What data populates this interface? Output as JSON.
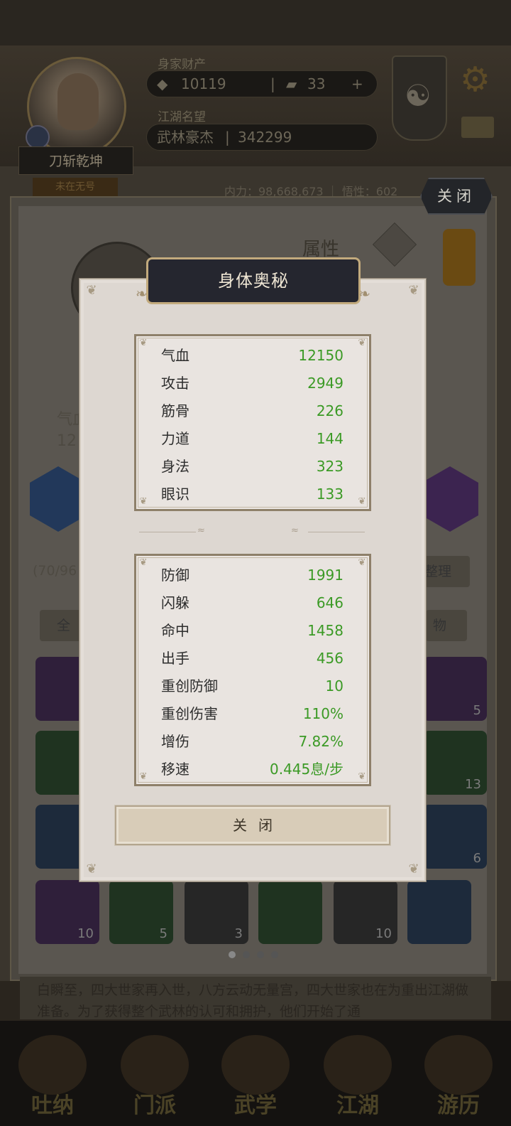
{
  "background": {
    "resources_label": "身家财产",
    "currency_1": "10119",
    "currency_2": "33",
    "plus": "+",
    "fame_label": "江湖名望",
    "rank_title": "武林豪杰",
    "fame_value": "342299",
    "player_name": "刀斩乾坤",
    "title_tag": "未在无号",
    "top_stats": "内力：98,668,673 ｜ 悟性：602",
    "attr_title": "属性",
    "left_partial_label": "气血",
    "left_partial_value": "12",
    "inventory_count": "(70/96",
    "sort_button": "整理",
    "filter_all": "全",
    "filter_items": "物",
    "story_text": "白瞬至，四大世家再入世，八方云动无量宫，四大世家也在为重出江湖做准备。为了获得整个武林的认可和拥护，他们开始了通",
    "slot_counts": [
      "5",
      "13",
      "6",
      "10",
      "5",
      "3",
      "10"
    ],
    "nav": [
      "吐纳",
      "门派",
      "武学",
      "江湖",
      "游历"
    ],
    "close_top": "关闭"
  },
  "modal": {
    "title": "身体奥秘",
    "group1": [
      {
        "label": "气血",
        "value": "12150"
      },
      {
        "label": "攻击",
        "value": "2949"
      },
      {
        "label": "筋骨",
        "value": "226"
      },
      {
        "label": "力道",
        "value": "144"
      },
      {
        "label": "身法",
        "value": "323"
      },
      {
        "label": "眼识",
        "value": "133"
      }
    ],
    "group2": [
      {
        "label": "防御",
        "value": "1991"
      },
      {
        "label": "闪躲",
        "value": "646"
      },
      {
        "label": "命中",
        "value": "1458"
      },
      {
        "label": "出手",
        "value": "456"
      },
      {
        "label": "重创防御",
        "value": "10"
      },
      {
        "label": "重创伤害",
        "value": "110%"
      },
      {
        "label": "增伤",
        "value": "7.82%"
      },
      {
        "label": "移速",
        "value": "0.445息/步"
      }
    ],
    "close_label": "关闭"
  },
  "colors": {
    "value_green": "#3b9a25",
    "title_bar": "#25262f",
    "modal_bg": "#ddd7d1"
  }
}
